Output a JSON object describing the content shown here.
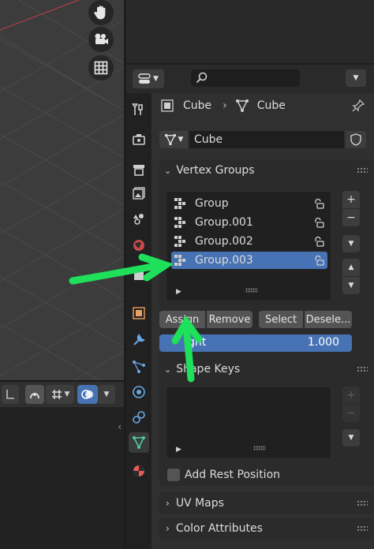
{
  "header": {
    "object_name": "Cube",
    "mesh_name": "Cube"
  },
  "datablock": {
    "mesh_name": "Cube"
  },
  "vertex_groups": {
    "title": "Vertex Groups",
    "items": [
      {
        "label": "Group"
      },
      {
        "label": "Group.001"
      },
      {
        "label": "Group.002"
      },
      {
        "label": "Group.003"
      }
    ],
    "selected_index": 3,
    "assign_label": "Assign",
    "remove_label": "Remove",
    "select_label": "Select",
    "deselect_label": "Desele...",
    "weight_label": "ght",
    "weight_value": "1.000"
  },
  "shape_keys": {
    "title": "Shape Keys",
    "add_rest_position_label": "Add Rest Position",
    "add_rest_position_checked": false
  },
  "collapsed_panels": {
    "uv_maps": "UV Maps",
    "color_attributes": "Color Attributes"
  },
  "colors": {
    "accent_blue": "#4772b3",
    "annotation_green": "#1fe05a",
    "panel_bg": "#303030",
    "viewport_bg": "#3c3c3c"
  },
  "icons": {
    "viewport_nav": [
      "hand-icon",
      "camera-icon",
      "grid-icon"
    ],
    "tabs": [
      "tool-icon",
      "render-icon",
      "output-icon",
      "view-layer-icon",
      "scene-icon",
      "world-icon",
      "collection-icon",
      "object-icon",
      "modifier-icon",
      "particles-icon",
      "physics-icon",
      "constraints-icon",
      "data-icon",
      "material-icon"
    ]
  }
}
